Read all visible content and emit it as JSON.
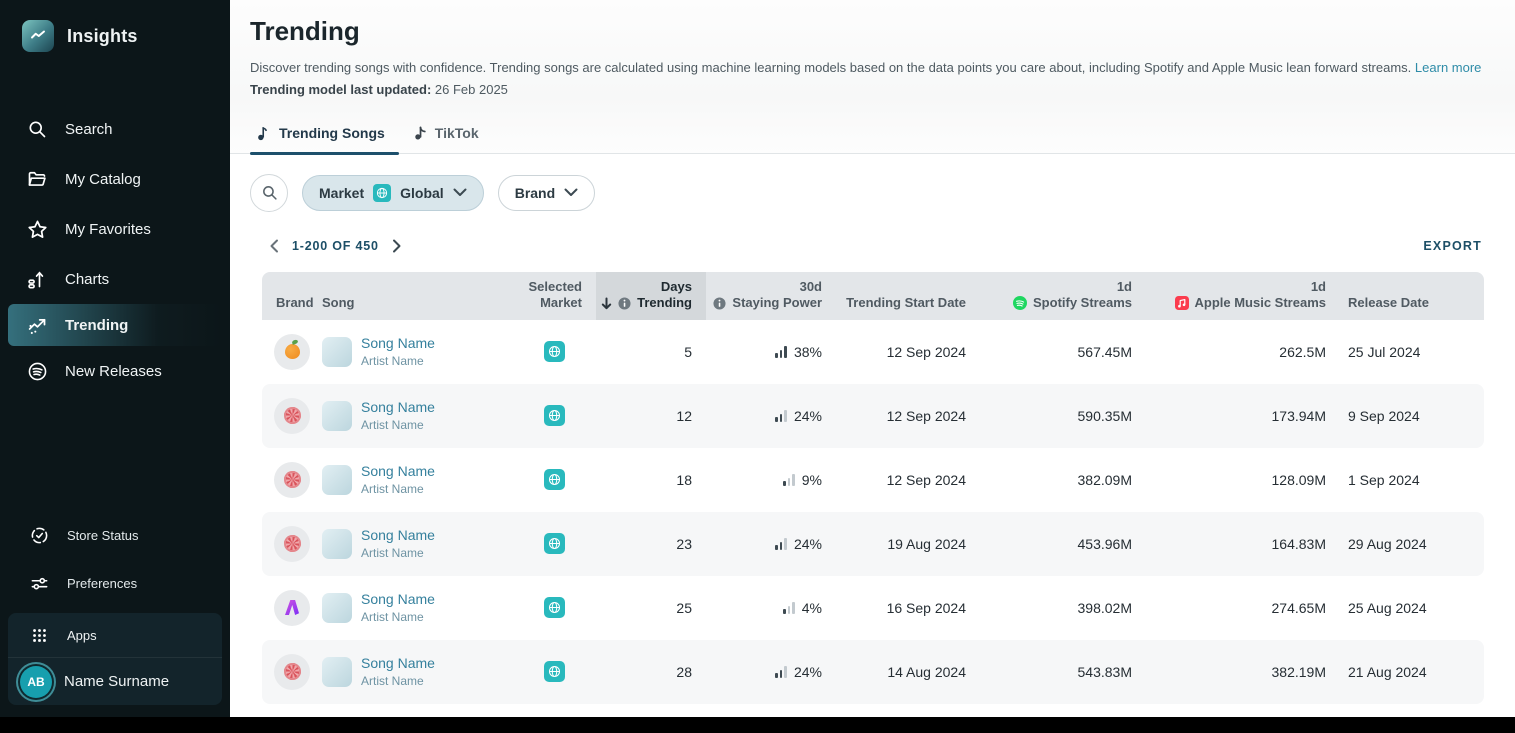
{
  "app_title": "Insights",
  "sidebar": {
    "nav": [
      {
        "label": "Search"
      },
      {
        "label": "My Catalog"
      },
      {
        "label": "My Favorites"
      },
      {
        "label": "Charts"
      },
      {
        "label": "Trending",
        "active": true
      },
      {
        "label": "New Releases"
      }
    ],
    "secondary": [
      {
        "label": "Store Status"
      },
      {
        "label": "Preferences"
      }
    ],
    "apps_label": "Apps",
    "user": {
      "initials": "AB",
      "name": "Name Surname"
    }
  },
  "header": {
    "title": "Trending",
    "description": "Discover trending songs with confidence. Trending songs are calculated using machine learning models based on the data points you care about, including Spotify and Apple Music lean forward streams.",
    "learn_more": "Learn more",
    "last_updated_label": "Trending model last updated:",
    "last_updated_value": " 26 Feb 2025"
  },
  "tabs": [
    {
      "label": "Trending Songs",
      "active": true
    },
    {
      "label": "TikTok",
      "active": false
    }
  ],
  "filters": {
    "market_label": "Market",
    "market_value": "Global",
    "brand_label": "Brand"
  },
  "pagination": {
    "range_text": "1-200 OF 450"
  },
  "export_label": "EXPORT",
  "table": {
    "columns": {
      "brand": "Brand",
      "song": "Song",
      "market_top": "Selected",
      "market_bottom": "Market",
      "days_top": "Days",
      "days_bottom": "Trending",
      "staying_top": "30d",
      "staying_bottom": "Staying Power",
      "start": "Trending Start Date",
      "spotify_top": "1d",
      "spotify_bottom": "Spotify Streams",
      "apple_top": "1d",
      "apple_bottom": "Apple Music Streams",
      "release": "Release Date"
    },
    "rows": [
      {
        "brand_logo": "orange-fruit-logo",
        "song": "Song Name",
        "artist": "Artist Name",
        "market": "Global",
        "days": "5",
        "staying": "38%",
        "staying_bars": 3,
        "start": "12 Sep 2024",
        "spotify": "567.45M",
        "apple": "262.5M",
        "release": "25 Jul 2024"
      },
      {
        "brand_logo": "red-flower-logo",
        "song": "Song Name",
        "artist": "Artist Name",
        "market": "Global",
        "days": "12",
        "staying": "24%",
        "staying_bars": 2,
        "start": "12 Sep 2024",
        "spotify": "590.35M",
        "apple": "173.94M",
        "release": "9 Sep 2024"
      },
      {
        "brand_logo": "red-flower-logo",
        "song": "Song Name",
        "artist": "Artist Name",
        "market": "Global",
        "days": "18",
        "staying": "9%",
        "staying_bars": 1,
        "start": "12 Sep 2024",
        "spotify": "382.09M",
        "apple": "128.09M",
        "release": "1 Sep 2024"
      },
      {
        "brand_logo": "red-flower-logo",
        "song": "Song Name",
        "artist": "Artist Name",
        "market": "Global",
        "days": "23",
        "staying": "24%",
        "staying_bars": 2,
        "start": "19 Aug 2024",
        "spotify": "453.96M",
        "apple": "164.83M",
        "release": "29 Aug 2024"
      },
      {
        "brand_logo": "purple-a-logo",
        "song": "Song Name",
        "artist": "Artist Name",
        "market": "Global",
        "days": "25",
        "staying": "4%",
        "staying_bars": 1,
        "start": "16 Sep 2024",
        "spotify": "398.02M",
        "apple": "274.65M",
        "release": "25 Aug 2024"
      },
      {
        "brand_logo": "red-flower-logo",
        "song": "Song Name",
        "artist": "Artist Name",
        "market": "Global",
        "days": "28",
        "staying": "24%",
        "staying_bars": 2,
        "start": "14 Aug 2024",
        "spotify": "543.83M",
        "apple": "382.19M",
        "release": "21 Aug 2024"
      }
    ]
  },
  "colors": {
    "sidebar_bg": "#0c1619",
    "accent_teal": "#29b9bd",
    "link": "#2e8ca8",
    "tab_underline": "#1d506c",
    "spotify_green": "#1ed760",
    "apple_red": "#fb3c4e",
    "song_link": "#35809d",
    "header_bg": "#e3e6e9",
    "sorted_header_bg": "#d4d8db"
  }
}
